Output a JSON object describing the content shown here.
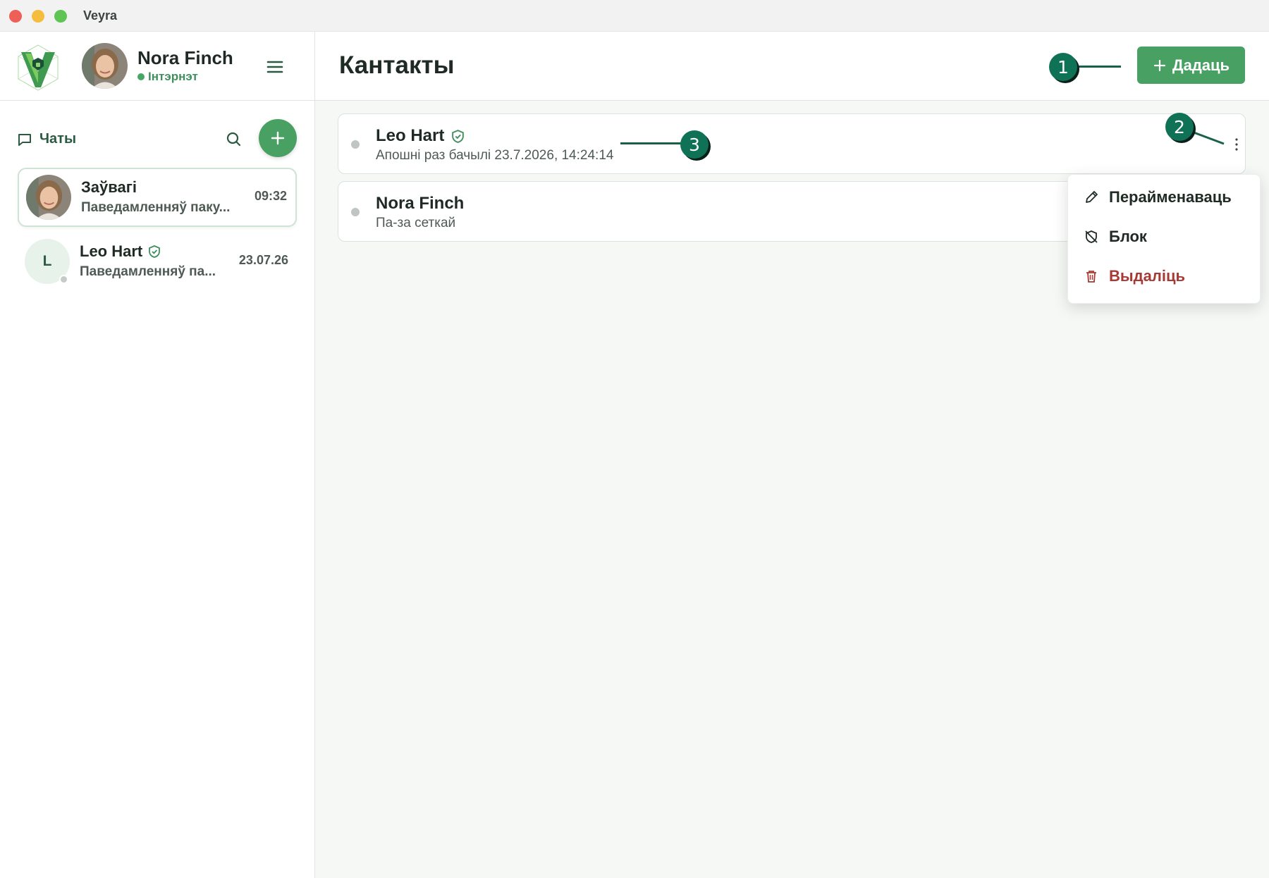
{
  "window": {
    "title": "Veyra"
  },
  "user": {
    "name": "Nora Finch",
    "status": "Інтэрнэт"
  },
  "sidebar": {
    "section_label": "Чаты",
    "chats": [
      {
        "title": "Заўвагі",
        "preview": "Паведамленняў паку...",
        "time": "09:32",
        "verified": false
      },
      {
        "title": "Leo Hart",
        "preview": "Паведамленняў па...",
        "time": "23.07.26",
        "verified": true,
        "initial": "L"
      }
    ]
  },
  "main": {
    "title": "Кантакты",
    "add_label": "Дадаць",
    "contacts": [
      {
        "name": "Leo Hart",
        "sub": "Апошні раз бачылі 23.7.2026, 14:24:14",
        "verified": true
      },
      {
        "name": "Nora Finch",
        "sub": "Па-за сеткай",
        "verified": false
      }
    ]
  },
  "context_menu": {
    "items": [
      {
        "label": "Перайменаваць",
        "icon": "pencil-icon"
      },
      {
        "label": "Блок",
        "icon": "shield-off-icon"
      },
      {
        "label": "Выдаліць",
        "icon": "trash-icon"
      }
    ]
  },
  "callouts": [
    "1",
    "2",
    "3"
  ],
  "colors": {
    "accent": "#48a163",
    "danger": "#a73a34",
    "callout": "#0f7256"
  }
}
